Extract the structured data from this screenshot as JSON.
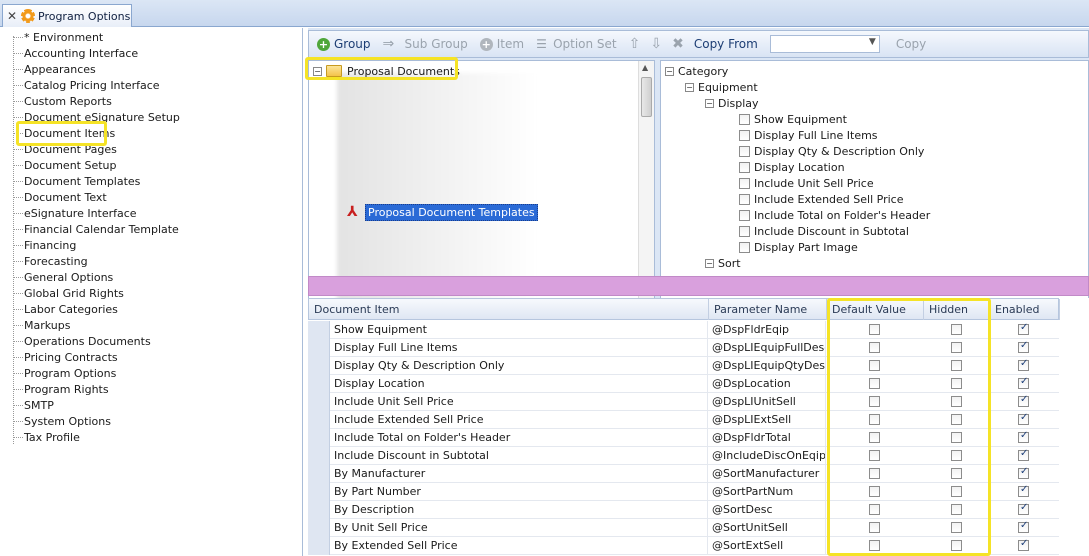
{
  "tab": {
    "title": "Program Options",
    "close_glyph": "✕"
  },
  "left_tree": {
    "items": [
      "* Environment",
      "Accounting Interface",
      "Appearances",
      "Catalog Pricing Interface",
      "Custom Reports",
      "Document eSignature Setup",
      "Document Items",
      "Document Pages",
      "Document Setup",
      "Document Templates",
      "Document Text",
      "eSignature Interface",
      "Financial Calendar Template",
      "Financing",
      "Forecasting",
      "General Options",
      "Global Grid Rights",
      "Labor Categories",
      "Markups",
      "Operations Documents",
      "Pricing Contracts",
      "Program Options",
      "Program Rights",
      "SMTP",
      "System Options",
      "Tax Profile"
    ],
    "selected": "Document Items"
  },
  "toolbar": {
    "group": "Group",
    "sub_group": "Sub Group",
    "item": "Item",
    "option_set": "Option Set",
    "copy_from": "Copy From",
    "copy": "Copy",
    "copy_from_value": ""
  },
  "docs_tree": {
    "root": "Proposal Documents",
    "child": "Proposal Document Templates"
  },
  "category_tree": {
    "root": "Category",
    "equipment": "Equipment",
    "display": "Display",
    "display_items": [
      "Show Equipment",
      "Display Full Line Items",
      "Display Qty & Description Only",
      "Display Location",
      "Include Unit Sell Price",
      "Include Extended Sell Price",
      "Include Total on Folder's Header",
      "Include Discount in Subtotal",
      "Display Part Image"
    ],
    "sort": "Sort"
  },
  "grid": {
    "columns": {
      "document_item": "Document Item",
      "parameter_name": "Parameter Name",
      "default_value": "Default Value",
      "hidden": "Hidden",
      "enabled": "Enabled"
    },
    "rows": [
      {
        "item": "Show Equipment",
        "param": "@DspFldrEqip",
        "default": false,
        "hidden": false,
        "enabled": true
      },
      {
        "item": "Display Full Line Items",
        "param": "@DspLIEquipFullDesc",
        "default": false,
        "hidden": false,
        "enabled": true
      },
      {
        "item": "Display Qty & Description Only",
        "param": "@DspLIEquipQtyDesc",
        "default": false,
        "hidden": false,
        "enabled": true
      },
      {
        "item": "Display Location",
        "param": "@DspLocation",
        "default": false,
        "hidden": false,
        "enabled": true
      },
      {
        "item": "Include Unit Sell Price",
        "param": "@DspLIUnitSell",
        "default": false,
        "hidden": false,
        "enabled": true
      },
      {
        "item": "Include Extended Sell Price",
        "param": "@DspLIExtSell",
        "default": false,
        "hidden": false,
        "enabled": true
      },
      {
        "item": "Include Total on Folder's Header",
        "param": "@DspFldrTotal",
        "default": false,
        "hidden": false,
        "enabled": true
      },
      {
        "item": "Include Discount in Subtotal",
        "param": "@IncludeDiscOnEqip",
        "default": false,
        "hidden": false,
        "enabled": true
      },
      {
        "item": "By Manufacturer",
        "param": "@SortManufacturer",
        "default": false,
        "hidden": false,
        "enabled": true
      },
      {
        "item": "By Part Number",
        "param": "@SortPartNum",
        "default": false,
        "hidden": false,
        "enabled": true
      },
      {
        "item": "By Description",
        "param": "@SortDesc",
        "default": false,
        "hidden": false,
        "enabled": true
      },
      {
        "item": "By Unit Sell Price",
        "param": "@SortUnitSell",
        "default": false,
        "hidden": false,
        "enabled": true
      },
      {
        "item": "By Extended Sell Price",
        "param": "@SortExtSell",
        "default": false,
        "hidden": false,
        "enabled": true
      }
    ]
  },
  "colors": {
    "highlight": "#f5e326",
    "band": "#d9a0dd",
    "selection": "#2a6ad6"
  }
}
